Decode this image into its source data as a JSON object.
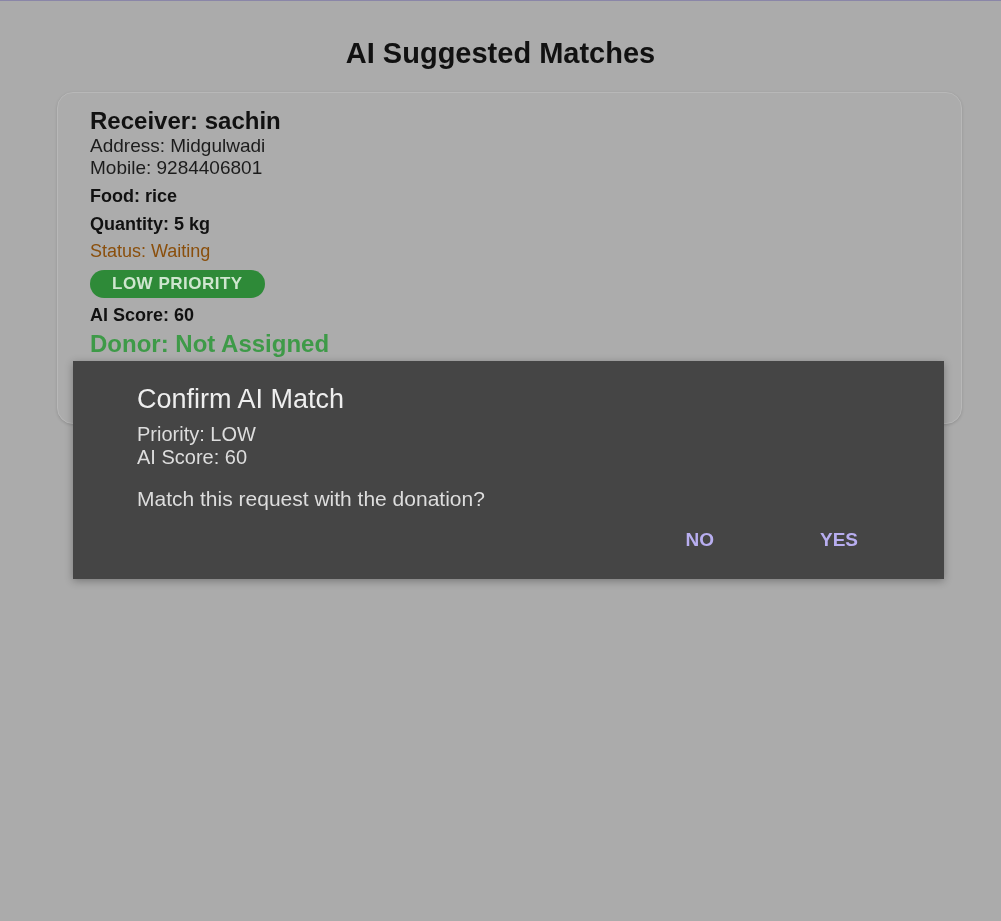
{
  "title": "AI Suggested Matches",
  "match_card": {
    "receiver": "Receiver: sachin",
    "address": "Address: Midgulwadi",
    "mobile": "Mobile: 9284406801",
    "food": "Food: rice",
    "quantity": "Quantity: 5 kg",
    "status": "Status: Waiting",
    "priority_badge": "LOW PRIORITY",
    "ai_score": "AI Score: 60",
    "donor": "Donor: Not Assigned"
  },
  "dialog": {
    "title": "Confirm AI Match",
    "priority": "Priority: LOW",
    "ai_score": "AI Score: 60",
    "message": "Match this request with the donation?",
    "buttons": [
      "NO",
      "YES"
    ]
  }
}
